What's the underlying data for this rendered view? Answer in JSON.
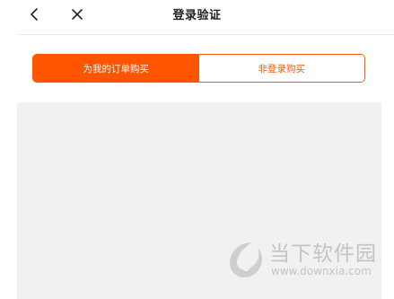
{
  "header": {
    "title": "登录验证",
    "back_icon": "chevron-left-icon",
    "close_icon": "close-icon"
  },
  "tabs": [
    {
      "label": "为我的订单购买",
      "active": true
    },
    {
      "label": "非登录购买",
      "active": false
    }
  ],
  "watermark": {
    "brand": "当下软件园",
    "url": "www.downxia.com"
  },
  "colors": {
    "accent": "#ff5500",
    "content_bg": "#f1f1f1",
    "watermark": "#c4c4c4"
  }
}
